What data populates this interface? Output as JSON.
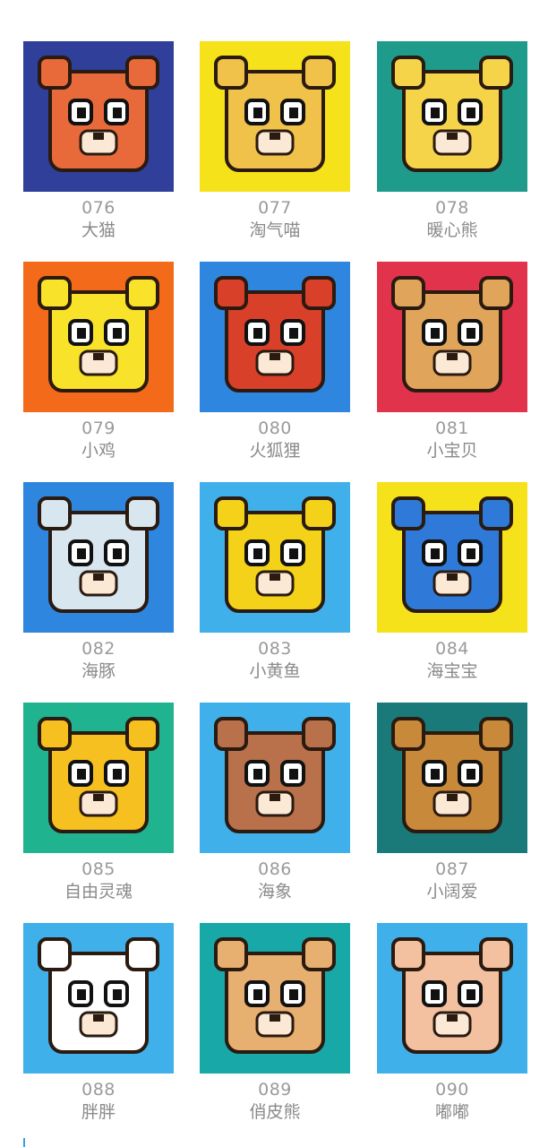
{
  "items": [
    {
      "num": "076",
      "name": "大猫",
      "bg": "#2f3f9a",
      "face": "#e86a3a",
      "icon": "tiger-face-icon"
    },
    {
      "num": "077",
      "name": "淘气喵",
      "bg": "#f6e21a",
      "face": "#f0c24a",
      "icon": "cat-face-icon"
    },
    {
      "num": "078",
      "name": "暖心熊",
      "bg": "#1f9b8c",
      "face": "#f5d44a",
      "icon": "bear-face-icon"
    },
    {
      "num": "079",
      "name": "小鸡",
      "bg": "#f26a1a",
      "face": "#f8e22a",
      "icon": "chick-icon"
    },
    {
      "num": "080",
      "name": "火狐狸",
      "bg": "#2e86de",
      "face": "#d9402a",
      "icon": "fox-face-icon"
    },
    {
      "num": "081",
      "name": "小宝贝",
      "bg": "#e2334d",
      "face": "#e0a55a",
      "icon": "teddy-bear-icon"
    },
    {
      "num": "082",
      "name": "海豚",
      "bg": "#2e86de",
      "face": "#d8e6f0",
      "icon": "dolphin-icon"
    },
    {
      "num": "083",
      "name": "小黄鱼",
      "bg": "#3fb0ea",
      "face": "#f5d21a",
      "icon": "yellow-fish-icon"
    },
    {
      "num": "084",
      "name": "海宝宝",
      "bg": "#f6e21a",
      "face": "#2f7ad8",
      "icon": "hippo-icon"
    },
    {
      "num": "085",
      "name": "自由灵魂",
      "bg": "#1fb38f",
      "face": "#f6c020",
      "icon": "fish-whale-icon"
    },
    {
      "num": "086",
      "name": "海象",
      "bg": "#3fb0ea",
      "face": "#b8714a",
      "icon": "walrus-icon"
    },
    {
      "num": "087",
      "name": "小阔爱",
      "bg": "#1a7a7a",
      "face": "#c8893a",
      "icon": "dog-face-icon"
    },
    {
      "num": "088",
      "name": "胖胖",
      "bg": "#3fb0ea",
      "face": "#ffffff",
      "icon": "panda-face-icon"
    },
    {
      "num": "089",
      "name": "俏皮熊",
      "bg": "#19a8a8",
      "face": "#e8b070",
      "icon": "lion-bear-icon"
    },
    {
      "num": "090",
      "name": "嘟嘟",
      "bg": "#3fb0ea",
      "face": "#f3c0a0",
      "icon": "baby-face-icon"
    }
  ]
}
